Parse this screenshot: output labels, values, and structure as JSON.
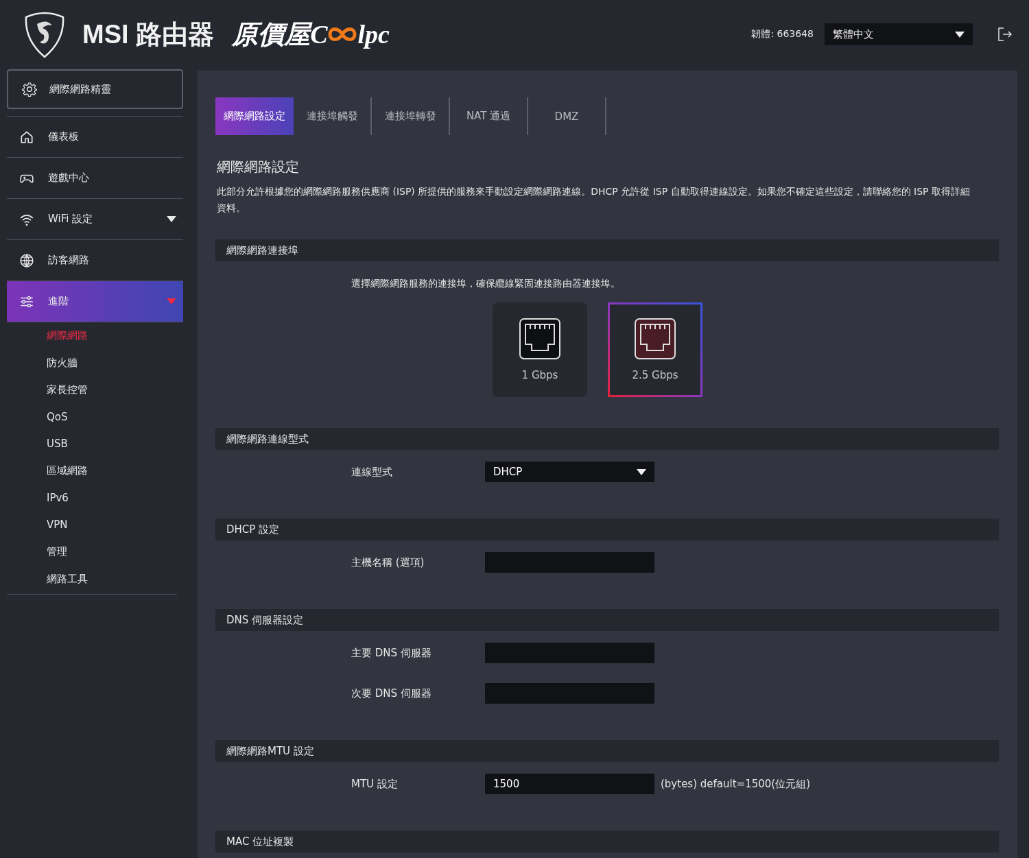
{
  "header": {
    "brand": "MSI 路由器",
    "partner_prefix": "原價屋C",
    "partner_suffix": "lpc",
    "firmware": "韌體: 663648",
    "language": "繁體中文"
  },
  "sidebar": {
    "wizard": "網際網路精靈",
    "items": [
      {
        "label": "儀表板",
        "expandable": false,
        "selected": false
      },
      {
        "label": "遊戲中心",
        "expandable": false,
        "selected": false
      },
      {
        "label": "WiFi 設定",
        "expandable": true,
        "expanded": false,
        "selected": false
      },
      {
        "label": "訪客網路",
        "expandable": false,
        "selected": false
      },
      {
        "label": "進階",
        "expandable": true,
        "expanded": true,
        "selected": true,
        "children": [
          {
            "label": "網際網路",
            "selected": true
          },
          {
            "label": "防火牆",
            "selected": false
          },
          {
            "label": "家長控管",
            "selected": false
          },
          {
            "label": "QoS",
            "selected": false
          },
          {
            "label": "USB",
            "selected": false
          },
          {
            "label": "區域網路",
            "selected": false
          },
          {
            "label": "IPv6",
            "selected": false
          },
          {
            "label": "VPN",
            "selected": false
          },
          {
            "label": "管理",
            "selected": false
          },
          {
            "label": "網路工具",
            "selected": false
          }
        ]
      }
    ]
  },
  "tabs": [
    {
      "label": "網際網路設定",
      "selected": true
    },
    {
      "label": "連接埠觸發",
      "selected": false
    },
    {
      "label": "連接埠轉發",
      "selected": false
    },
    {
      "label": "NAT 通過",
      "selected": false
    },
    {
      "label": "DMZ",
      "selected": false
    }
  ],
  "page": {
    "title": "網際網路設定",
    "description": "此部分允許根據您的網際網路服務供應商 (ISP) 所提供的服務來手動設定網際網路連線。DHCP 允許從 ISP 自動取得連線設定。如果您不確定這些設定，請聯絡您的 ISP 取得詳細資料。"
  },
  "sections": [
    {
      "kind": "ports",
      "heading": "網際網路連接埠",
      "hint": "選擇網際網路服務的連接埠，確保纜線緊固連接路由器連接埠。",
      "ports": [
        {
          "label": "1 Gbps",
          "selected": false
        },
        {
          "label": "2.5 Gbps",
          "selected": true
        }
      ]
    },
    {
      "kind": "fields",
      "heading": "網際網路連線型式",
      "rows": [
        {
          "kind": "select",
          "label": "連線型式",
          "value": "DHCP"
        }
      ]
    },
    {
      "kind": "fields",
      "heading": "DHCP 設定",
      "rows": [
        {
          "kind": "input",
          "label": "主機名稱 (選項)"
        }
      ]
    },
    {
      "kind": "fields",
      "heading": "DNS 伺服器設定",
      "rows": [
        {
          "kind": "input",
          "label": "主要 DNS 伺服器"
        },
        {
          "kind": "input",
          "label": "次要 DNS 伺服器"
        }
      ]
    },
    {
      "kind": "fields",
      "heading": "網際網路MTU 設定",
      "rows": [
        {
          "kind": "input",
          "label": "MTU 設定",
          "value": "1500",
          "suffix": "(bytes) default=1500(位元組)"
        }
      ]
    },
    {
      "kind": "fields",
      "heading": "MAC 位址複製"
    }
  ]
}
